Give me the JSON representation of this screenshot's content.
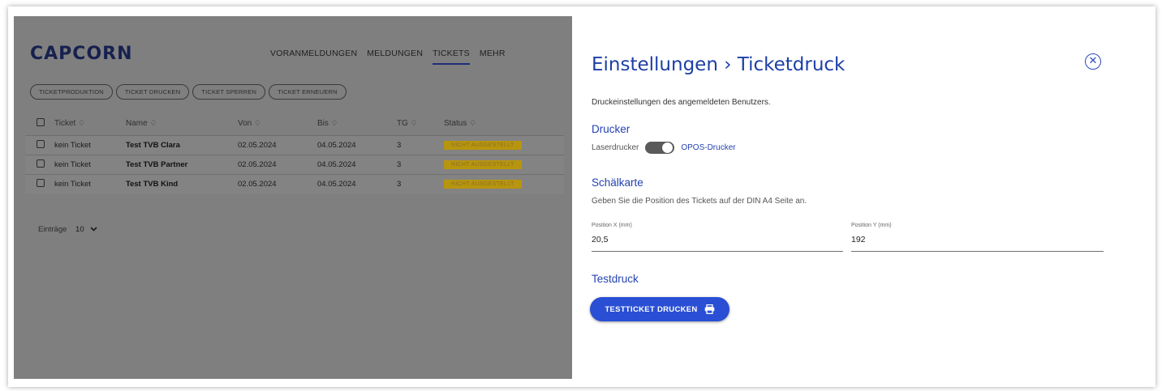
{
  "app": {
    "logo": "CAPCORN",
    "nav": [
      "VORANMELDUNGEN",
      "MELDUNGEN",
      "TICKETS",
      "MEHR"
    ],
    "nav_active": "TICKETS",
    "subtabs": [
      "TICKETPRODUKTION",
      "TICKET DRUCKEN",
      "TICKET SPERREN",
      "TICKET ERNEUERN"
    ],
    "table": {
      "headers": [
        "Ticket ♢",
        "Name ♢",
        "Von ♢",
        "Bis ♢",
        "TG ♢",
        "Status ♢"
      ],
      "rows": [
        {
          "ticket": "kein Ticket",
          "name": "Test TVB Clara",
          "von": "02.05.2024",
          "bis": "04.05.2024",
          "tg": "3",
          "status": "NICHT AUSGESTELLT"
        },
        {
          "ticket": "kein Ticket",
          "name": "Test TVB Partner",
          "von": "02.05.2024",
          "bis": "04.05.2024",
          "tg": "3",
          "status": "NICHT AUSGESTELLT"
        },
        {
          "ticket": "kein Ticket",
          "name": "Test TVB Kind",
          "von": "02.05.2024",
          "bis": "04.05.2024",
          "tg": "3",
          "status": "NICHT AUSGESTELLT"
        }
      ]
    },
    "entries_label": "Einträge",
    "entries_value": "10"
  },
  "panel": {
    "title": "Einstellungen › Ticketdruck",
    "close_icon": "close-circle-icon",
    "intro": "Druckeinstellungen des angemeldeten Benutzers.",
    "printer": {
      "heading": "Drucker",
      "left_label": "Laserdrucker",
      "right_label": "OPOS-Drucker",
      "toggle_on": true
    },
    "peel": {
      "heading": "Schälkarte",
      "hint": "Geben Sie die Position des Tickets auf der DIN A4 Seite an.",
      "x_label": "Position X (mm)",
      "x_value": "20,5",
      "y_label": "Position Y (mm)",
      "y_value": "192"
    },
    "test": {
      "heading": "Testdruck",
      "button": "TESTTICKET DRUCKEN",
      "button_icon": "printer-icon"
    }
  },
  "colors": {
    "accent": "#2a4fd4",
    "heading": "#2442b0",
    "badge": "#b8950f",
    "overlay": "#7f7f7f"
  }
}
